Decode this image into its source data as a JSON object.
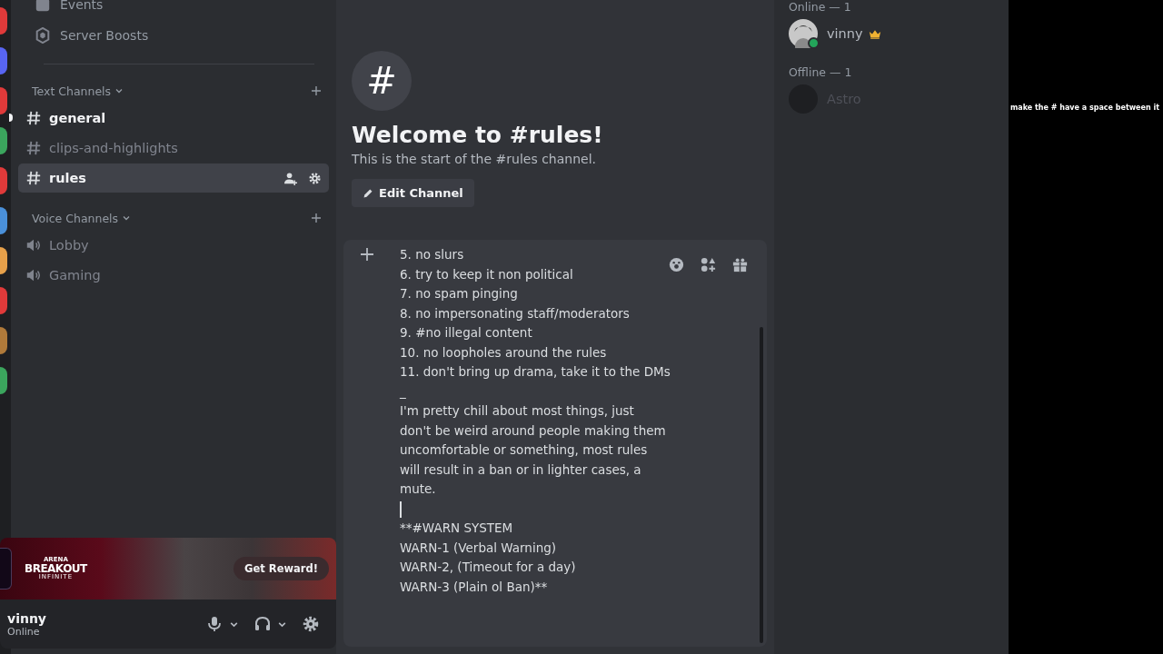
{
  "sidebar": {
    "top_items": [
      {
        "label": "Events",
        "kind": "calendar"
      },
      {
        "label": "Server Boosts",
        "kind": "boost"
      }
    ],
    "categories": [
      {
        "label": "Text Channels",
        "expanded": true,
        "channels": [
          {
            "name": "general",
            "kind": "text",
            "selected": false,
            "unread": true
          },
          {
            "name": "clips-and-highlights",
            "kind": "text",
            "selected": false,
            "unread": false
          },
          {
            "name": "rules",
            "kind": "text",
            "selected": true,
            "unread": false
          }
        ]
      },
      {
        "label": "Voice Channels",
        "expanded": true,
        "channels": [
          {
            "name": "Lobby",
            "kind": "voice",
            "selected": false,
            "unread": false
          },
          {
            "name": "Gaming",
            "kind": "voice",
            "selected": false,
            "unread": false
          }
        ]
      }
    ],
    "promo": {
      "logo_top": "ARENA",
      "logo_main": "BREAKOUT",
      "logo_sub": "INFINITE",
      "button": "Get Reward!"
    },
    "user": {
      "name": "vinny",
      "status": "Online"
    }
  },
  "channel_intro": {
    "icon": "#",
    "title": "Welcome to #rules!",
    "subtitle": "This is the start of the #rules channel.",
    "button": "Edit Channel"
  },
  "composer": {
    "lines": [
      {
        "kind": "text",
        "text": "5. no slurs"
      },
      {
        "kind": "text",
        "text": "6. try to keep it non political"
      },
      {
        "kind": "text",
        "text": "7. no spam pinging"
      },
      {
        "kind": "text",
        "text": "8. no impersonating staff/moderators"
      },
      {
        "kind": "text",
        "text": "9. #no illegal content"
      },
      {
        "kind": "text",
        "text": "10. no loopholes around the rules"
      },
      {
        "kind": "text",
        "text": "11. don't bring up drama, take it to the DMs"
      },
      {
        "kind": "text",
        "text": "_"
      },
      {
        "kind": "text",
        "text": "I'm pretty chill about most things, just"
      },
      {
        "kind": "text",
        "text": "don't be weird around people making them"
      },
      {
        "kind": "text",
        "text": "uncomfortable or something, most rules"
      },
      {
        "kind": "text",
        "text": "will result in a ban or in lighter cases, a"
      },
      {
        "kind": "text",
        "text": "mute."
      },
      {
        "kind": "cursor"
      },
      {
        "kind": "text",
        "text": "**#WARN SYSTEM"
      },
      {
        "kind": "text",
        "text": "WARN-1  (Verbal Warning)"
      },
      {
        "kind": "text",
        "text": "WARN-2, (Timeout for a day)"
      },
      {
        "kind": "text",
        "text": "WARN-3 (Plain ol Ban)**"
      }
    ]
  },
  "members": {
    "groups": [
      {
        "label": "Online — 1",
        "members": [
          {
            "name": "vinny",
            "online": true,
            "owner": true
          }
        ]
      },
      {
        "label": "Offline — 1",
        "members": [
          {
            "name": "Astro",
            "online": false,
            "owner": false
          }
        ]
      }
    ]
  },
  "overlay": {
    "message": "make the # have a space between it"
  }
}
